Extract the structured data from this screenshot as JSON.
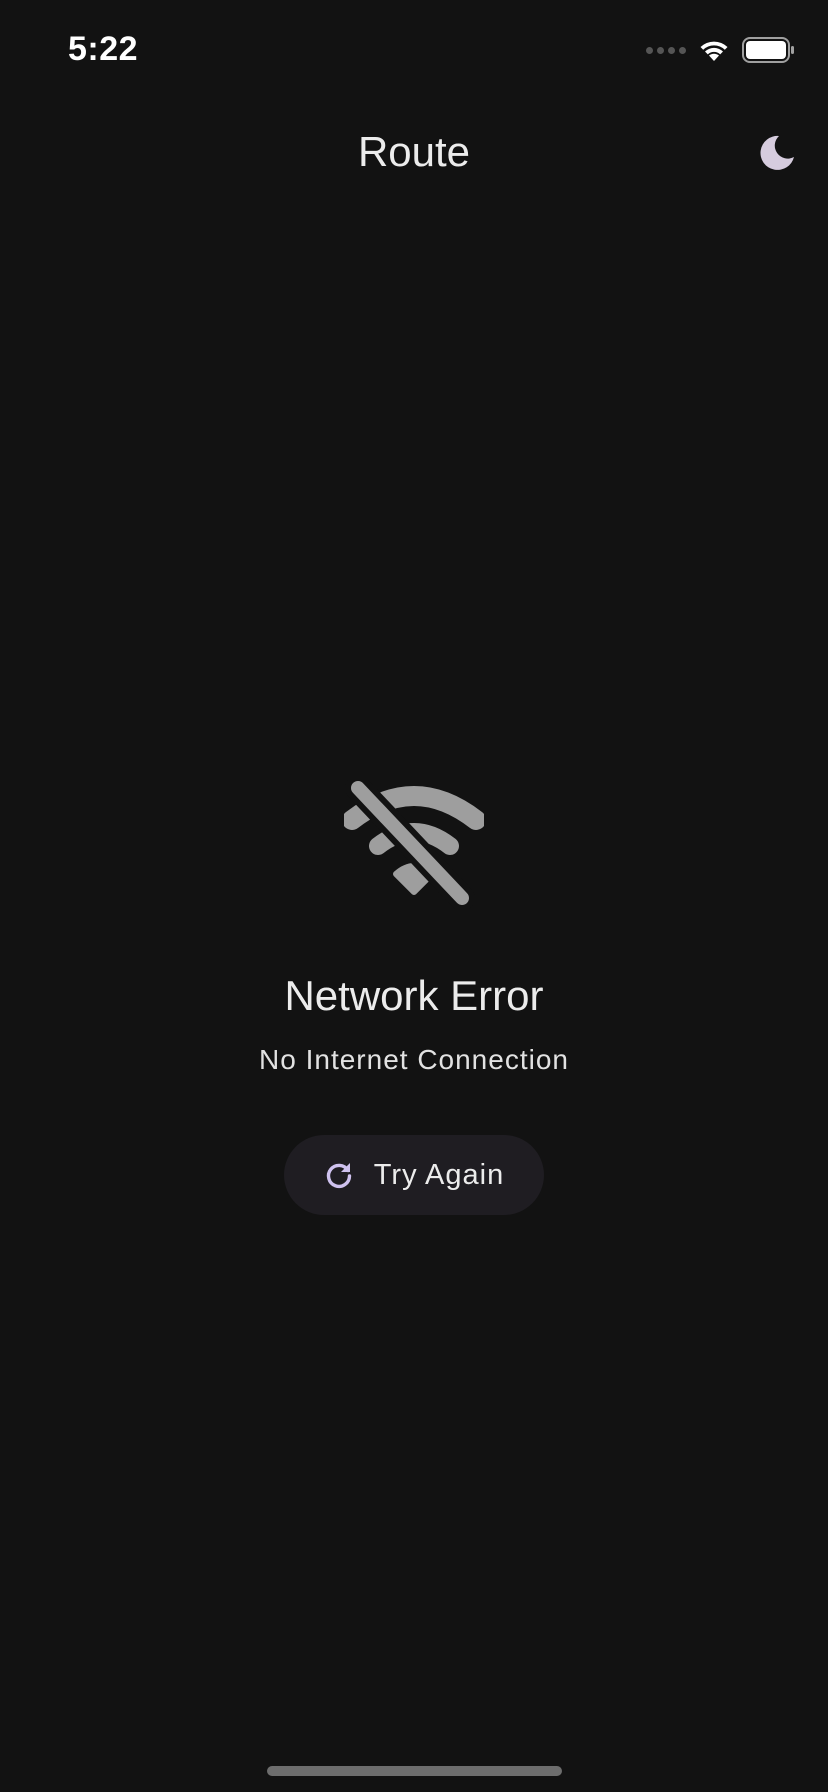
{
  "status_bar": {
    "time": "5:22",
    "icons": [
      "signal-dots-icon",
      "wifi-icon",
      "battery-icon"
    ]
  },
  "app_bar": {
    "title": "Route",
    "theme_toggle_icon": "moon-icon"
  },
  "error": {
    "icon": "wifi-off-icon",
    "title": "Network Error",
    "subtitle": "No Internet Connection"
  },
  "retry_button": {
    "icon": "refresh-icon",
    "label": "Try Again"
  },
  "colors": {
    "background": "#121212",
    "text": "#ececec",
    "icon_muted": "#9e9e9e",
    "accent": "#cfc2ef",
    "button_bg": "#1f1d22"
  }
}
